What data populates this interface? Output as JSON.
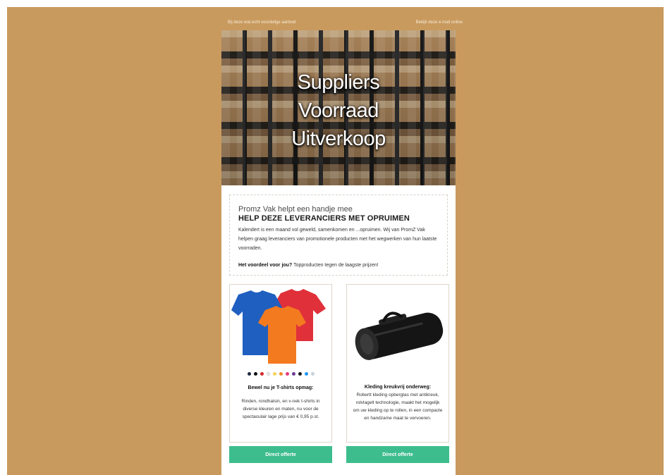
{
  "preheader": {
    "left_text": "Bij deze wat echt voordelige aanbod",
    "right_text": "Bekijk deze e-mail online"
  },
  "hero": {
    "line1": "Suppliers",
    "line2": "Voorraad",
    "line3": "Uitverkoop"
  },
  "intro": {
    "subtitle": "Promz Vak helpt een handje mee",
    "heading": "HELP DEZE LEVERANCIERS MET OPRUIMEN",
    "body": "Kalendert is een maand vol geweld, samenkomen en ...opruimen. Wij van PromZ Vak helpen graag leveranciers van promotionele producten met het wegwerken van hun laatste voorraden.",
    "benefit_label": "Het voordeel voor jou?",
    "benefit_text": "Topproducten tegen de laagste prijzen!"
  },
  "products": [
    {
      "title": "Bewel nu je T-shirts opmag:",
      "text": "Rinden, rondhalsin, en v-nek t-shirts in diverse kleuren en maten, nu voor de spectaculair lage prijs van € 0,95 p.st.",
      "cta": "Direct offerte",
      "swatch_colors": [
        "#1f2b44",
        "#111111",
        "#d62828",
        "#f1f1f1",
        "#f4d35e",
        "#f28c28",
        "#e63b7a",
        "#6a3d9a",
        "#1a1a1a",
        "#2196f3",
        "#c7d2dc"
      ]
    },
    {
      "title": "Kleding kreukvrij onderweg:",
      "text": "Robertt kleding opbergtas met antikreuk, rolvlagelt technologie, maakt het mogelijk om uw kleding op te rollen, in een compacte en handzame maat te vervoeren.",
      "cta": "Direct offerte"
    }
  ],
  "colors": {
    "background": "#c99a5e",
    "cta": "#3dbd8d"
  }
}
